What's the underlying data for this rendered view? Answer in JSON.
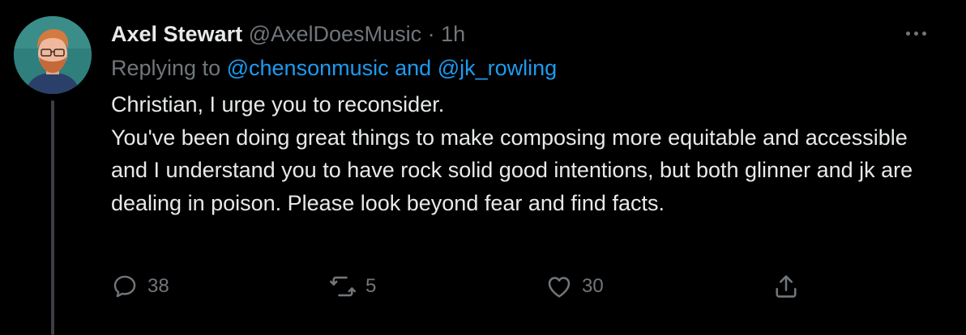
{
  "tweet": {
    "author": {
      "display_name": "Axel Stewart",
      "handle": "@AxelDoesMusic",
      "separator": "·",
      "timestamp": "1h"
    },
    "replying_to": {
      "prefix": "Replying to",
      "mention_1": "@chensonmusic",
      "conjunction": "and",
      "mention_2": "@jk_rowling"
    },
    "text_lines": [
      "Christian, I urge you to reconsider.",
      "You've been doing great things to make composing more equitable and accessible and I understand you to have rock solid good intentions, but both glinner and jk are dealing in poison. Please look beyond fear and find facts."
    ],
    "actions": {
      "reply_icon": "reply-icon",
      "reply_count": "38",
      "retweet_icon": "retweet-icon",
      "retweet_count": "5",
      "like_icon": "heart-icon",
      "like_count": "30",
      "share_icon": "share-icon"
    }
  },
  "colors": {
    "background": "#000000",
    "primary_text": "#e7e9ea",
    "secondary_text": "#71767b",
    "link": "#1d9bf0",
    "thread_line": "#3c4044"
  }
}
